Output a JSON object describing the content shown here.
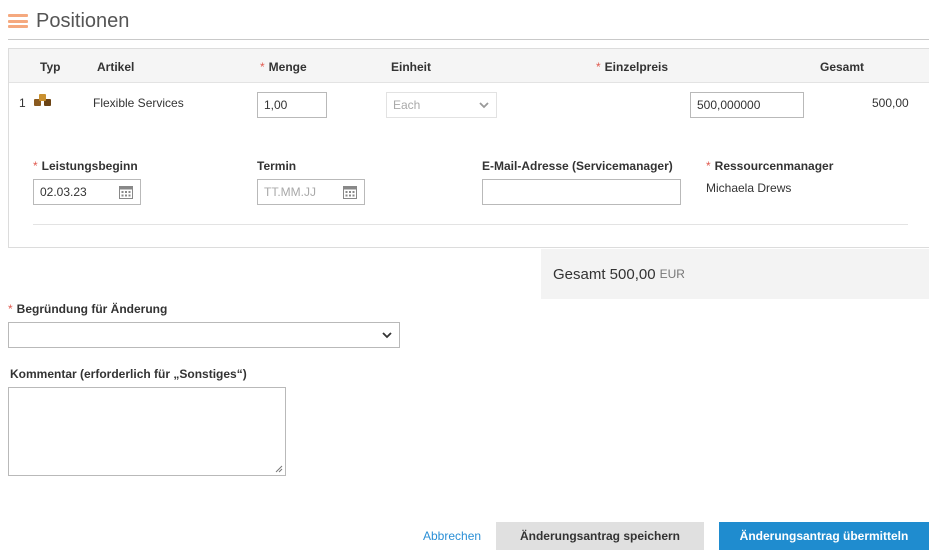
{
  "section": {
    "title": "Positionen",
    "icon": "list-lines-icon"
  },
  "table": {
    "columns": {
      "typ": "Typ",
      "artikel": "Artikel",
      "menge": "Menge",
      "einheit": "Einheit",
      "einzelpreis": "Einzelpreis",
      "gesamt": "Gesamt"
    },
    "required_marker": "*",
    "rows": [
      {
        "num": "1",
        "type_icon": "services-icon",
        "artikel": "Flexible Services",
        "menge": "1,00",
        "einheit": "Each",
        "einzelpreis": "500,000000",
        "gesamt": "500,00"
      }
    ]
  },
  "details": {
    "leistungsbeginn": {
      "label": "Leistungsbeginn",
      "value": "02.03.23"
    },
    "termin": {
      "label": "Termin",
      "placeholder": "TT.MM.JJ"
    },
    "email": {
      "label": "E-Mail-Adresse (Servicemanager)",
      "value": ""
    },
    "ressourcenmanager": {
      "label": "Ressourcenmanager",
      "value": "Michaela Drews"
    }
  },
  "total": {
    "label": "Gesamt 500,00",
    "currency": "EUR"
  },
  "reason": {
    "label": "Begründung für Änderung",
    "value": ""
  },
  "comment": {
    "label": "Kommentar (erforderlich für „Sonstiges“)",
    "value": ""
  },
  "actions": {
    "cancel": "Abbrechen",
    "save": "Änderungsantrag speichern",
    "submit": "Änderungsantrag übermitteln"
  },
  "colors": {
    "accent": "#1f8ccf",
    "link": "#2a8fd6",
    "required": "#e05a4f",
    "icon_orange": "#f5a97f"
  }
}
